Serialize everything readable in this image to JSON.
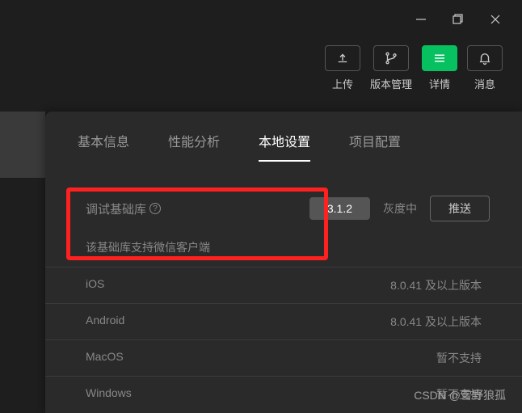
{
  "toolbar": {
    "upload": "上传",
    "version": "版本管理",
    "details": "详情",
    "notifications": "消息"
  },
  "tabs": {
    "basic": "基本信息",
    "perf": "性能分析",
    "local": "本地设置",
    "project": "项目配置"
  },
  "debug_lib": {
    "label": "调试基础库",
    "version": "3.1.2",
    "gray_status": "灰度中",
    "push": "推送"
  },
  "hint": "该基础库支持微信客户端",
  "support": [
    {
      "os": "iOS",
      "req": "8.0.41 及以上版本"
    },
    {
      "os": "Android",
      "req": "8.0.41 及以上版本"
    },
    {
      "os": "MacOS",
      "req": "暂不支持"
    },
    {
      "os": "Windows",
      "req": "暂不支持"
    }
  ],
  "watermark": "CSDN @雪野狼孤"
}
